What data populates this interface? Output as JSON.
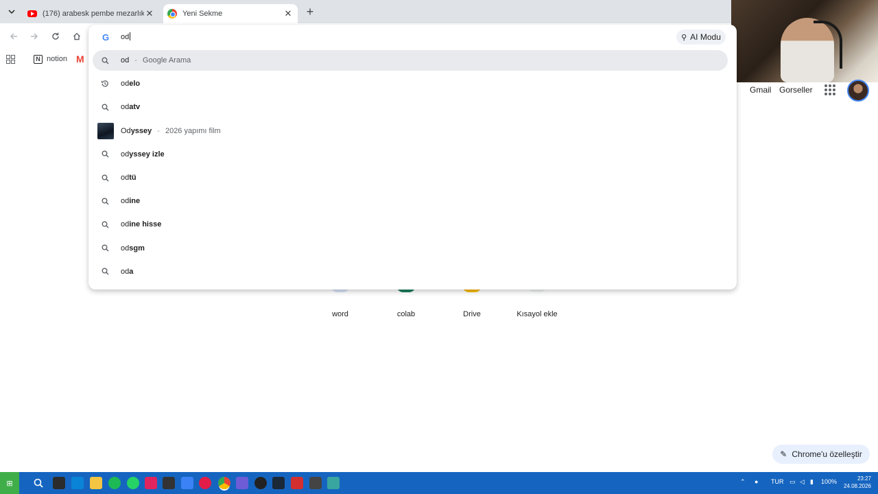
{
  "tabs": [
    {
      "title": "(176) arabesk pembe mezarlık..."
    },
    {
      "title": "Yeni Sekme"
    }
  ],
  "bookmarks": {
    "notion": "notion",
    "gmail": "M"
  },
  "omnibox": {
    "typed": "od",
    "ai_mode_label": "AI Modu",
    "suggestions": [
      {
        "icon": "search-icon",
        "match": "od",
        "rest": "",
        "desc": "Google Arama"
      },
      {
        "icon": "history-icon",
        "match": "od",
        "rest": "elo",
        "desc": ""
      },
      {
        "icon": "search-icon",
        "match": "od",
        "rest": "atv",
        "desc": ""
      },
      {
        "icon": "movie-thumbnail",
        "match": "Od",
        "rest": "yssey",
        "desc": "2026 yapımı film"
      },
      {
        "icon": "search-icon",
        "match": "od",
        "rest": "yssey izle",
        "desc": ""
      },
      {
        "icon": "search-icon",
        "match": "od",
        "rest": "tü",
        "desc": ""
      },
      {
        "icon": "search-icon",
        "match": "od",
        "rest": "ine",
        "desc": ""
      },
      {
        "icon": "search-icon",
        "match": "od",
        "rest": "ine hisse",
        "desc": ""
      },
      {
        "icon": "search-icon",
        "match": "od",
        "rest": "sgm",
        "desc": ""
      },
      {
        "icon": "search-icon",
        "match": "od",
        "rest": "a",
        "desc": ""
      }
    ]
  },
  "header_links": {
    "gmail": "Gmail",
    "images": "Gorseller"
  },
  "shortcuts": [
    {
      "label": "word"
    },
    {
      "label": "colab"
    },
    {
      "label": "Drive"
    },
    {
      "label": "Kısayol ekle"
    }
  ],
  "customize_label": "Chrome'u özelleştir",
  "taskbar": {
    "lang": "TUR",
    "battery": "100%",
    "time": "23:27",
    "date": "24.08.2026"
  },
  "colors": {
    "accent": "#4285f4",
    "taskbar": "#1565c0",
    "start": "#3fae49"
  }
}
